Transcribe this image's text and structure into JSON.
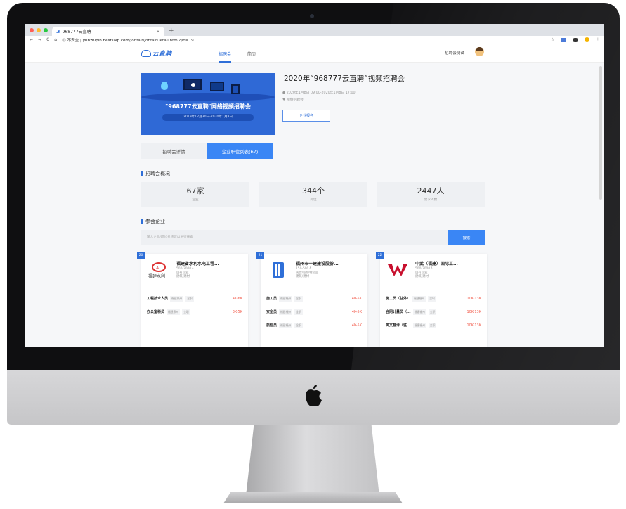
{
  "browser": {
    "tab_title": "968777云直聘",
    "tab_close": "×",
    "new_tab": "+",
    "address": {
      "security_label": "不安全",
      "domain": "yunzhipin.bestsaip.com",
      "path": "/jobfair/JobfairDetail.html?jid=191"
    }
  },
  "site": {
    "logo_text": "云直聘",
    "nav": [
      "招聘会",
      "简历"
    ],
    "user_name": "招聘会测试"
  },
  "event": {
    "banner_title": "\"968777云直聘\"网络视频招聘会",
    "banner_date": "2019年12月30日-2020年1月8日",
    "title": "2020年“968777云直聘”视频招聘会",
    "time": "2020年1月8日 09:00-2020年1月8日 17:00",
    "location": "视频招聘会",
    "signup_button": "企业报名"
  },
  "tabs": [
    "招聘会详情",
    "企业职位列表(67)"
  ],
  "overview": {
    "title": "招聘会概况",
    "stats": [
      {
        "value": "67家",
        "label": "企业"
      },
      {
        "value": "344个",
        "label": "岗位"
      },
      {
        "value": "2447人",
        "label": "需求人数"
      }
    ]
  },
  "companies_section": {
    "title": "参会企业",
    "search_placeholder": "输入企业/职位名称可以进行搜索",
    "search_button": "搜索"
  },
  "companies": [
    {
      "rank": "20",
      "name": "福建省水利水电工程...",
      "size": "500-2000人",
      "type": "国有企业",
      "industry": "建筑/建材",
      "jobs": [
        {
          "title": "工程技术人员",
          "loc": "福建泉州",
          "kind": "全职",
          "salary": "4K-6K"
        },
        {
          "title": "办公室科员",
          "loc": "福建泉州",
          "kind": "全职",
          "salary": "3K-5K"
        }
      ]
    },
    {
      "rank": "21",
      "name": "福州市一建建设股份...",
      "size": "150-500人",
      "type": "民营/股份制企业",
      "industry": "建筑/建材",
      "jobs": [
        {
          "title": "施工员",
          "loc": "福建福州",
          "kind": "全职",
          "salary": "4K-5K"
        },
        {
          "title": "安全员",
          "loc": "福建福州",
          "kind": "全职",
          "salary": "4K-5K"
        },
        {
          "title": "质检员",
          "loc": "福建福州",
          "kind": "全职",
          "salary": "4K-5K"
        }
      ]
    },
    {
      "rank": "22",
      "name": "中武（福建）国际工...",
      "size": "500-2000人",
      "type": "国有企业",
      "industry": "建筑/建材",
      "jobs": [
        {
          "title": "施工员（驻外）",
          "loc": "福建福州",
          "kind": "全职",
          "salary": "10K-13K"
        },
        {
          "title": "合同计量员（...",
          "loc": "福建福州",
          "kind": "全职",
          "salary": "10K-13K"
        },
        {
          "title": "英文翻译（驻...",
          "loc": "福建福州",
          "kind": "全职",
          "salary": "10K-13K"
        }
      ]
    }
  ],
  "colors": {
    "brand_blue": "#2f6fd8",
    "tab_active": "#3a86f5",
    "salary_red": "#f25b4b",
    "panel_gray": "#eef0f3"
  }
}
